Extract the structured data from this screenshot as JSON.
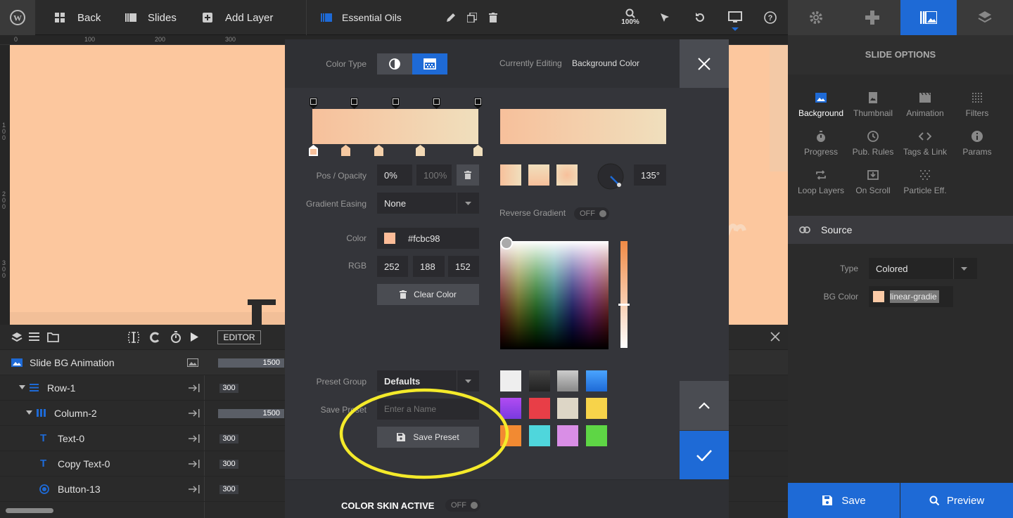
{
  "topbar": {
    "back_label": "Back",
    "slides_label": "Slides",
    "add_layer_label": "Add Layer",
    "slider_name": "Essential Oils",
    "zoom": "100%"
  },
  "right_tabs": [
    "settings",
    "navigation",
    "slide-options",
    "layers"
  ],
  "ruler": {
    "top": [
      "0",
      "100",
      "200",
      "300"
    ],
    "left": [
      "1\n0\n0",
      "2\n0\n0",
      "3\n0\n0"
    ]
  },
  "timeline": {
    "editor_label": "EDITOR",
    "rows": [
      {
        "label": "Slide BG Animation",
        "value": "1500"
      },
      {
        "label": "Row-1",
        "value": "300"
      },
      {
        "label": "Column-2",
        "value": "1500"
      },
      {
        "label": "Text-0",
        "value": "300"
      },
      {
        "label": "Copy Text-0",
        "value": "300"
      },
      {
        "label": "Button-13",
        "value": "300"
      }
    ]
  },
  "slide_options": {
    "title": "SLIDE OPTIONS",
    "items": [
      "Background",
      "Thumbnail",
      "Animation",
      "Filters",
      "Progress",
      "Pub. Rules",
      "Tags & Link",
      "Params",
      "Loop Layers",
      "On Scroll",
      "Particle Eff."
    ],
    "source_label": "Source",
    "type_label": "Type",
    "type_value": "Colored",
    "bg_color_label": "BG Color",
    "bg_color_value": "linear-gradie",
    "save_label": "Save",
    "preview_label": "Preview"
  },
  "modal": {
    "color_type_label": "Color Type",
    "currently_editing_label": "Currently Editing",
    "currently_editing_value": "Background Color",
    "pos_opacity_label": "Pos / Opacity",
    "pos_value": "0%",
    "opacity_value": "100%",
    "angle_value": "135°",
    "gradient_easing_label": "Gradient Easing",
    "gradient_easing_value": "None",
    "reverse_gradient_label": "Reverse Gradient",
    "reverse_gradient_value": "OFF",
    "color_label": "Color",
    "color_hex": "#fcbc98",
    "rgb_label": "RGB",
    "rgb": [
      "252",
      "188",
      "152"
    ],
    "clear_color_label": "Clear Color",
    "preset_group_label": "Preset Group",
    "preset_group_value": "Defaults",
    "save_preset_label": "Save Preset",
    "save_preset_placeholder": "Enter a Name",
    "save_preset_button": "Save Preset",
    "color_skin_label": "COLOR SKIN ACTIVE",
    "color_skin_value": "OFF",
    "gradient_from": "#f7c09b",
    "gradient_to": "#f0dfbd",
    "presets": [
      "#eeeeee",
      "#333333",
      "#aaaaaa",
      "#2b8cf2",
      "#9b4cf2",
      "#e83e47",
      "#ddd6c6",
      "#f7d34a",
      "#f28a32",
      "#4fd6dc",
      "#d98ee6",
      "#5ed645"
    ]
  },
  "colors": {
    "accent": "#1e6ad6",
    "canvas": "#fcc79e",
    "highlight_circle": "#f4ea2a"
  }
}
